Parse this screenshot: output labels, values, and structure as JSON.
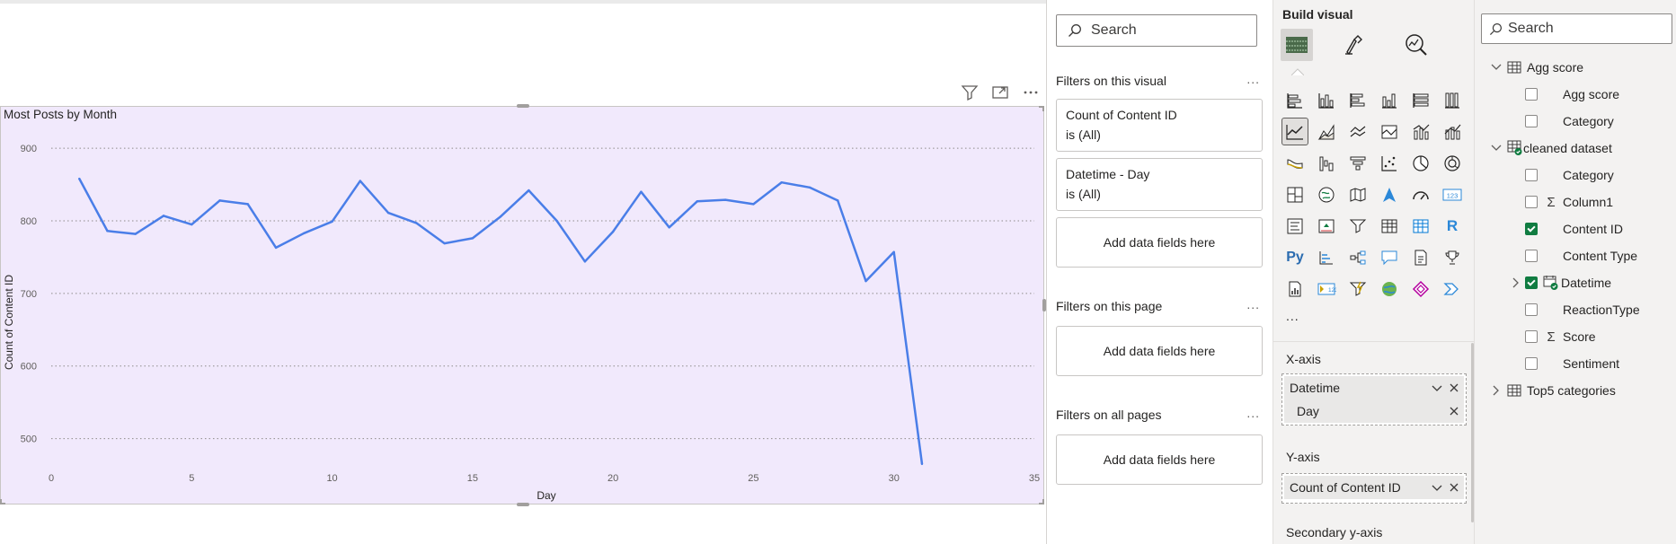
{
  "chart": {
    "title": "Most Posts by Month",
    "xlabel": "Day",
    "ylabel": "Count of Content ID"
  },
  "chart_data": {
    "type": "line",
    "title": "Most Posts by Month",
    "xlabel": "Day",
    "ylabel": "Count of Content ID",
    "xlim": [
      0,
      35
    ],
    "ylim": [
      450,
      920
    ],
    "x_ticks": [
      0,
      5,
      10,
      15,
      20,
      25,
      30,
      35
    ],
    "y_ticks": [
      500,
      600,
      700,
      800,
      900
    ],
    "grid": true,
    "series": [
      {
        "color": "#4a7ee8",
        "x": [
          1,
          2,
          3,
          4,
          5,
          6,
          7,
          8,
          9,
          10,
          11,
          12,
          13,
          14,
          15,
          16,
          17,
          18,
          19,
          20,
          21,
          22,
          23,
          24,
          25,
          26,
          27,
          28,
          29,
          30,
          31
        ],
        "y": [
          858,
          786,
          782,
          807,
          795,
          828,
          823,
          763,
          783,
          799,
          855,
          811,
          797,
          769,
          776,
          806,
          842,
          800,
          744,
          785,
          840,
          791,
          827,
          829,
          823,
          853,
          846,
          828,
          717,
          757,
          465
        ]
      }
    ]
  },
  "filters": {
    "search_placeholder": "Search",
    "on_visual_title": "Filters on this visual",
    "on_visual_cards": [
      {
        "field": "Count of Content ID",
        "state": "is (All)"
      },
      {
        "field": "Datetime - Day",
        "state": "is (All)"
      }
    ],
    "add_fields": "Add data fields here",
    "on_page_title": "Filters on this page",
    "on_all_title": "Filters on all pages",
    "more": "..."
  },
  "viz": {
    "title": "Build visual",
    "more": "...",
    "xaxis_label": "X-axis",
    "xaxis_field": "Datetime",
    "xaxis_sub": "Day",
    "yaxis_label": "Y-axis",
    "yaxis_field": "Count of Content ID",
    "secondary_label": "Secondary y-axis"
  },
  "data": {
    "search_placeholder": "Search",
    "tables": [
      {
        "name": "Agg score",
        "fields": [
          {
            "name": "Agg score",
            "checked": false
          },
          {
            "name": "Category",
            "checked": false
          }
        ]
      },
      {
        "name": "cleaned dataset",
        "fields": [
          {
            "name": "Category",
            "checked": false
          },
          {
            "name": "Column1",
            "checked": false
          },
          {
            "name": "Content ID",
            "checked": true
          },
          {
            "name": "Content Type",
            "checked": false
          },
          {
            "name": "Datetime",
            "checked": true
          },
          {
            "name": "ReactionType",
            "checked": false
          },
          {
            "name": "Score",
            "checked": false
          },
          {
            "name": "Sentiment",
            "checked": false
          }
        ]
      },
      {
        "name": "Top5 categories",
        "fields": []
      }
    ]
  }
}
